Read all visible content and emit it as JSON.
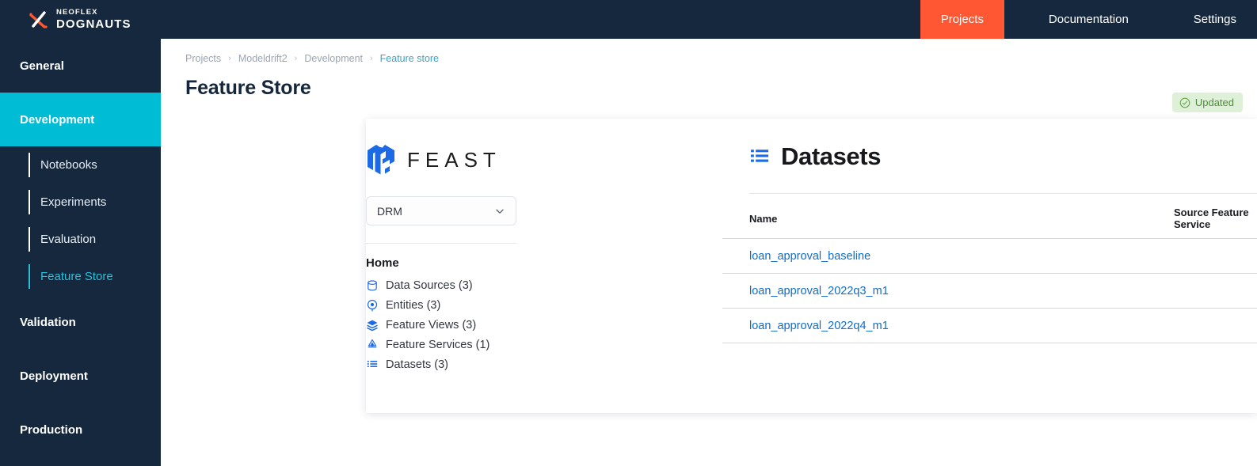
{
  "brand": {
    "top_line": "NEOFLEX",
    "bottom_line": "DOGNAUTS",
    "mark": "x-cross-icon",
    "color": "#ff5733"
  },
  "topnav": {
    "items": [
      {
        "label": "Projects",
        "active": true
      },
      {
        "label": "Documentation",
        "active": false
      },
      {
        "label": "Settings",
        "active": false
      }
    ],
    "active_color": "#ff5733"
  },
  "sidebar": {
    "background": "#15283d",
    "active_color": "#00bcd4",
    "groups": [
      {
        "label": "General",
        "active": false
      },
      {
        "label": "Development",
        "active": true
      },
      {
        "label": "Validation",
        "active": false
      },
      {
        "label": "Deployment",
        "active": false
      },
      {
        "label": "Production",
        "active": false
      }
    ],
    "sub_items": [
      {
        "label": "Notebooks",
        "active": false
      },
      {
        "label": "Experiments",
        "active": false
      },
      {
        "label": "Evaluation",
        "active": false
      },
      {
        "label": "Feature Store",
        "active": true
      }
    ]
  },
  "breadcrumb": {
    "items": [
      {
        "label": "Projects",
        "current": false
      },
      {
        "label": "Modeldrift2",
        "current": false
      },
      {
        "label": "Development",
        "current": false
      },
      {
        "label": "Feature store",
        "current": true
      }
    ],
    "separator": "›"
  },
  "page": {
    "title": "Feature Store"
  },
  "status": {
    "label": "Updated",
    "icon": "check-circle-icon",
    "bg": "#dff0d8",
    "fg": "#4f8a3d"
  },
  "feast": {
    "logo_icon": "feast-cube-logo-icon",
    "wordmark": "FEAST",
    "project_select": {
      "value": "DRM",
      "chevron": "chevron-down-icon"
    },
    "home_label": "Home",
    "nav": [
      {
        "label": "Data Sources (3)",
        "icon": "database-icon"
      },
      {
        "label": "Entities (3)",
        "icon": "target-icon"
      },
      {
        "label": "Feature Views (3)",
        "icon": "layers-icon"
      },
      {
        "label": "Feature Services (1)",
        "icon": "droplet-icon"
      },
      {
        "label": "Datasets (3)",
        "icon": "list-icon"
      }
    ]
  },
  "datasets": {
    "icon": "list-icon",
    "heading": "Datasets",
    "columns": [
      "Name",
      "Source Feature Service"
    ],
    "rows": [
      {
        "name": "loan_approval_baseline",
        "source_feature_service": ""
      },
      {
        "name": "loan_approval_2022q3_m1",
        "source_feature_service": ""
      },
      {
        "name": "loan_approval_2022q4_m1",
        "source_feature_service": ""
      }
    ],
    "link_color": "#0d6ecf"
  }
}
